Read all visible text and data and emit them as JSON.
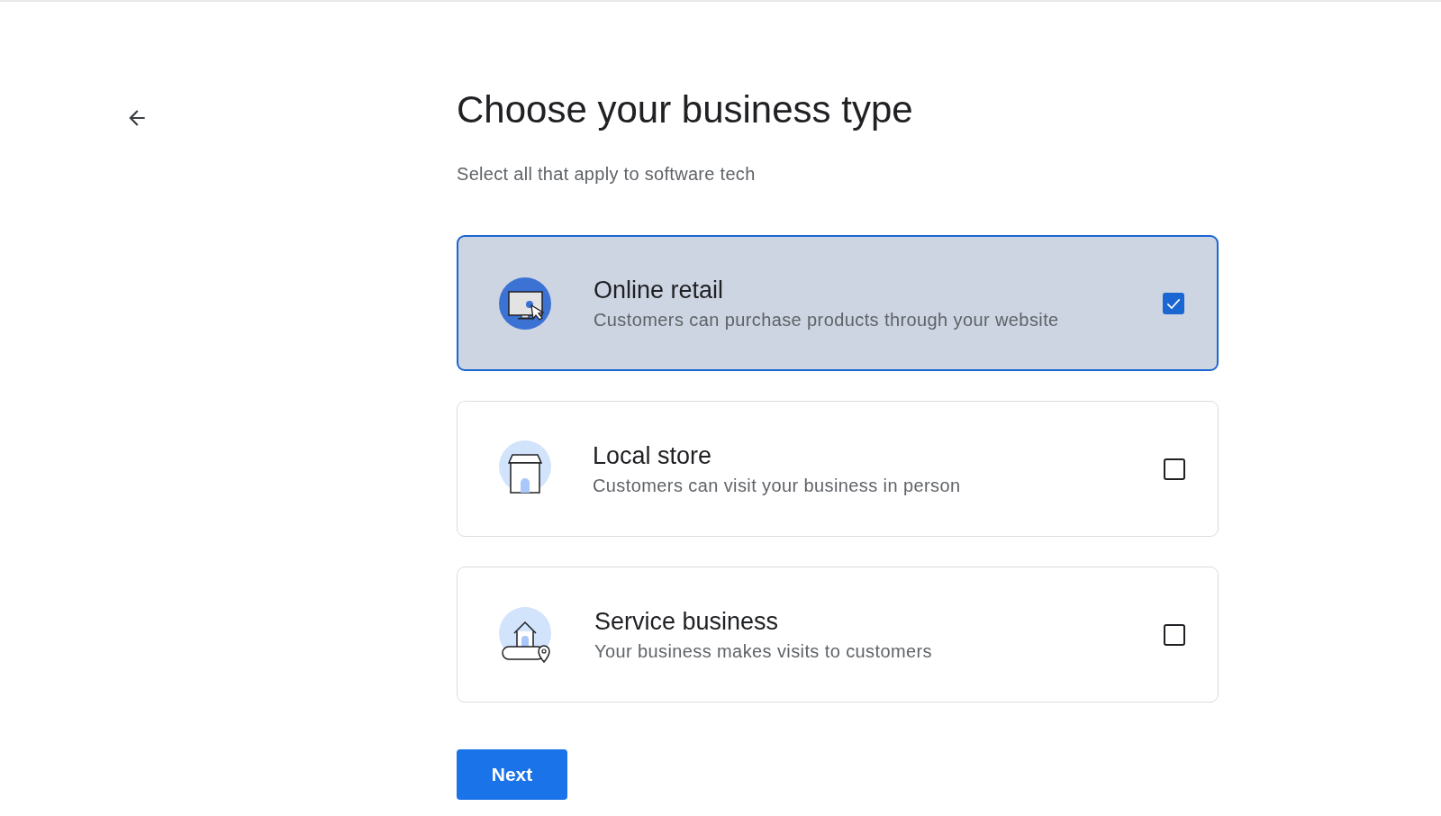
{
  "title": "Choose your business type",
  "subtitle": "Select all that apply to software tech",
  "options": [
    {
      "kind": "online",
      "title": "Online retail",
      "description": "Customers can purchase products through your website",
      "checked": true
    },
    {
      "kind": "store",
      "title": "Local store",
      "description": "Customers can visit your business in person",
      "checked": false
    },
    {
      "kind": "service",
      "title": "Service business",
      "description": "Your business makes visits to customers",
      "checked": false
    }
  ],
  "next_button": "Next"
}
